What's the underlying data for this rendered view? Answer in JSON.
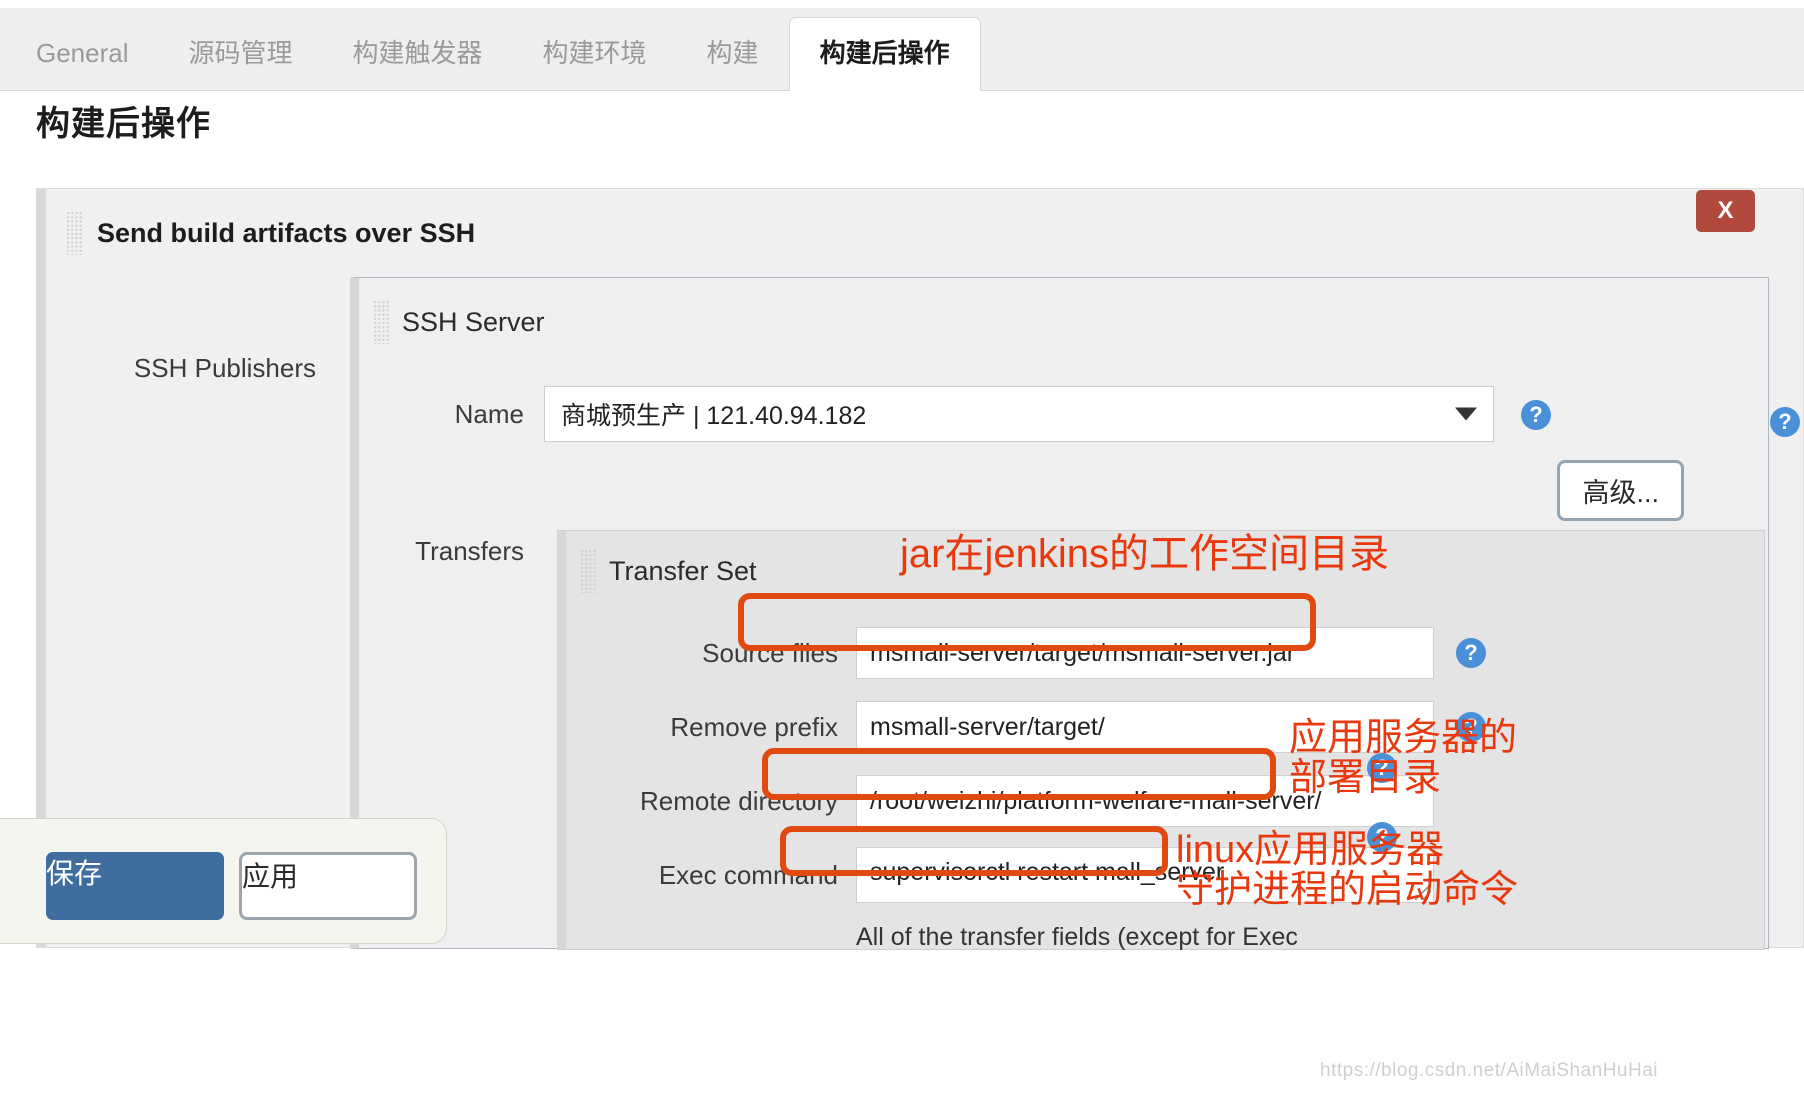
{
  "tabs": [
    {
      "label": "General",
      "active": false
    },
    {
      "label": "源码管理",
      "active": false
    },
    {
      "label": "构建触发器",
      "active": false
    },
    {
      "label": "构建环境",
      "active": false
    },
    {
      "label": "构建",
      "active": false
    },
    {
      "label": "构建后操作",
      "active": true
    }
  ],
  "page": {
    "title": "构建后操作"
  },
  "publisher": {
    "title": "Send build artifacts over SSH",
    "close_label": "X",
    "publishers_label": "SSH Publishers"
  },
  "ssh_server": {
    "title": "SSH Server",
    "name_label": "Name",
    "name_value": "商城预生产 | 121.40.94.182",
    "advanced_label": "高级...",
    "transfers_label": "Transfers"
  },
  "transfer_set": {
    "title": "Transfer Set",
    "fields": [
      {
        "label": "Source files",
        "value": "msmall-server/target/msmall-server.jar"
      },
      {
        "label": "Remove prefix",
        "value": "msmall-server/target/"
      },
      {
        "label": "Remote directory",
        "value": "/root/weizhi/platform-welfare-mall-server/"
      },
      {
        "label": "Exec command",
        "value": "supervisorctl restart mall_server"
      }
    ],
    "footnote": "All of the transfer fields (except for Exec"
  },
  "annotations": [
    {
      "id": "jar",
      "lines": [
        "jar在jenkins的工作空间目录"
      ]
    },
    {
      "id": "deploy",
      "lines": [
        "应用服务器的",
        "部署目录"
      ]
    },
    {
      "id": "linux",
      "lines": [
        "linux应用服务器",
        "守护进程的启动命令"
      ]
    }
  ],
  "footer": {
    "save_label": "保存",
    "apply_label": "应用"
  },
  "watermark": "https://blog.csdn.net/AiMaiShanHuHai",
  "icons": {
    "help": "?",
    "help_name": "help-icon",
    "drag_name": "drag-handle-icon",
    "chevron_name": "chevron-down-icon"
  },
  "colors": {
    "accent_blue": "#3f6d9e",
    "help_blue": "#4a90d9",
    "close_red": "#b14a3c",
    "annotation_orange": "#e8380d",
    "highlight_border": "#e04a10"
  }
}
